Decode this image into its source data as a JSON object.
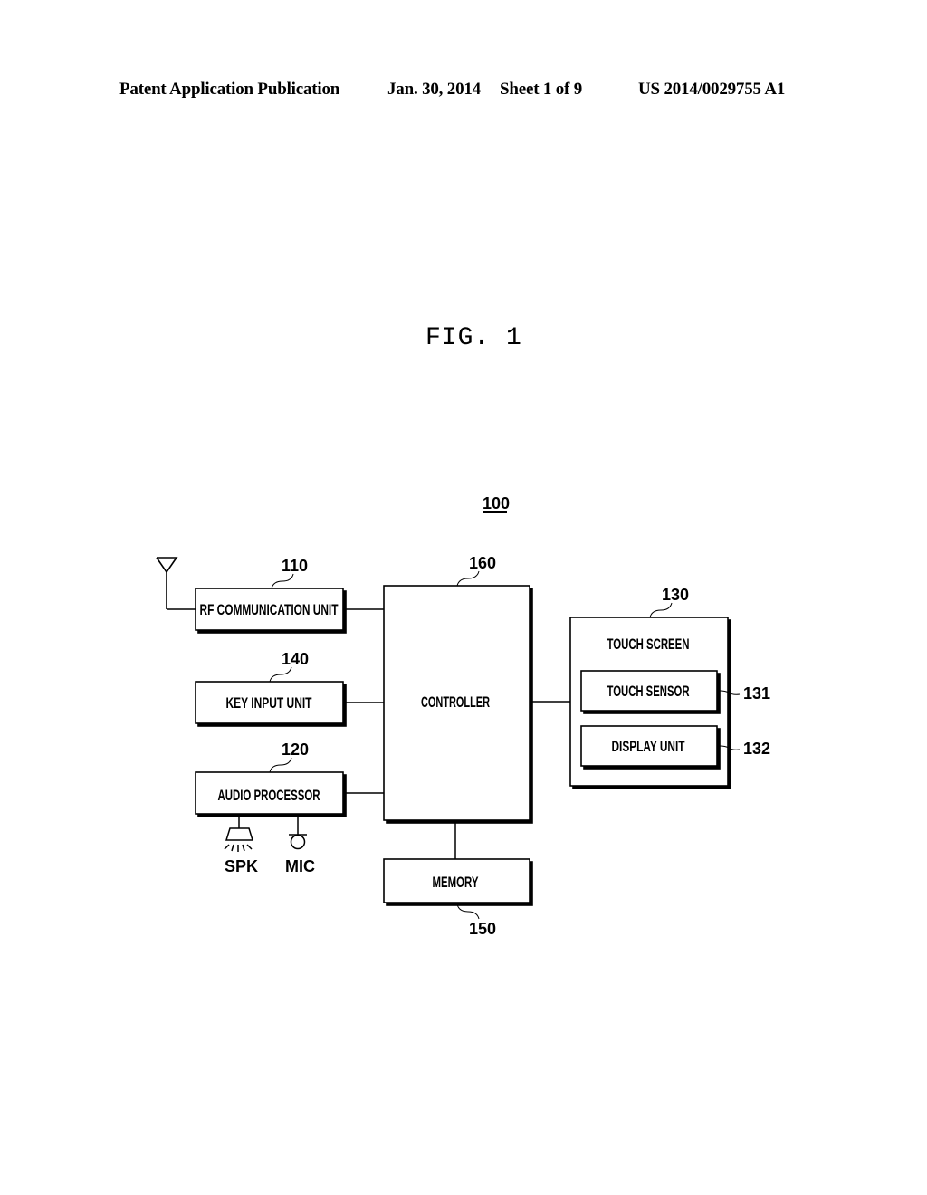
{
  "header": {
    "publication_type": "Patent Application Publication",
    "date": "Jan. 30, 2014",
    "sheet": "Sheet 1 of 9",
    "patent_number": "US 2014/0029755 A1"
  },
  "figure": {
    "title": "FIG. 1",
    "system_ref": "100"
  },
  "blocks": {
    "rf": {
      "label": "RF COMMUNICATION UNIT",
      "ref": "110"
    },
    "key_input": {
      "label": "KEY INPUT UNIT",
      "ref": "140"
    },
    "audio": {
      "label": "AUDIO PROCESSOR",
      "ref": "120"
    },
    "controller": {
      "label": "CONTROLLER",
      "ref": "160"
    },
    "memory": {
      "label": "MEMORY",
      "ref": "150"
    },
    "touch_screen": {
      "label": "TOUCH SCREEN",
      "ref": "130"
    },
    "touch_sensor": {
      "label": "TOUCH SENSOR",
      "ref": "131"
    },
    "display_unit": {
      "label": "DISPLAY UNIT",
      "ref": "132"
    }
  },
  "peripherals": {
    "speaker": "SPK",
    "microphone": "MIC"
  }
}
